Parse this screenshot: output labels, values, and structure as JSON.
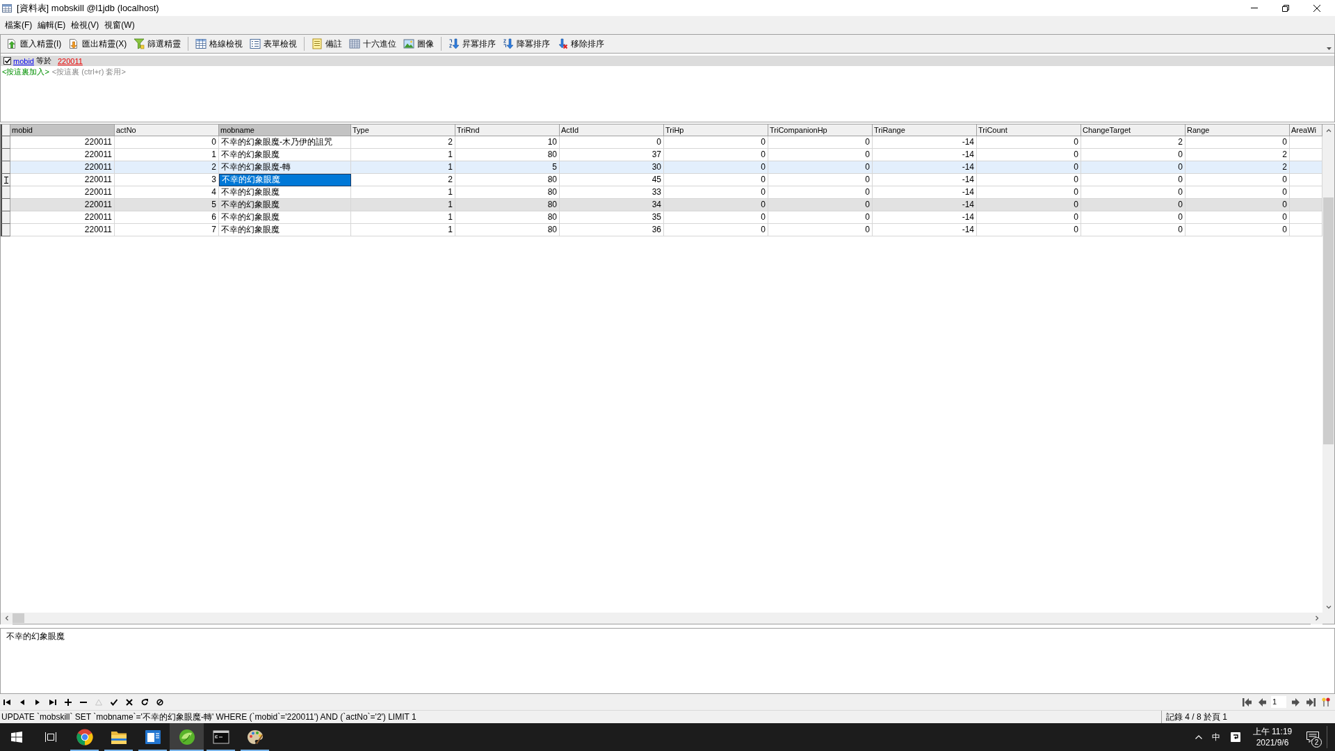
{
  "window": {
    "title": "[資料表] mobskill @l1jdb (localhost)"
  },
  "menu": [
    "檔案(F)",
    "編輯(E)",
    "檢視(V)",
    "視窗(W)"
  ],
  "toolbar": {
    "groups": [
      [
        {
          "kind": "import",
          "label": "匯入精靈(I)"
        },
        {
          "kind": "export",
          "label": "匯出精靈(X)"
        },
        {
          "kind": "filter",
          "label": "篩選精靈"
        }
      ],
      [
        {
          "kind": "grid",
          "label": "格線檢視"
        },
        {
          "kind": "form",
          "label": "表單檢視"
        }
      ],
      [
        {
          "kind": "memo",
          "label": "備註"
        },
        {
          "kind": "hex",
          "label": "十六進位"
        },
        {
          "kind": "image",
          "label": "圖像"
        }
      ],
      [
        {
          "kind": "sort_asc",
          "label": "昇冪排序"
        },
        {
          "kind": "sort_desc",
          "label": "降冪排序"
        },
        {
          "kind": "sort_clear",
          "label": "移除排序"
        }
      ]
    ]
  },
  "filter": {
    "checked": true,
    "field": "mobid",
    "operator": "等於",
    "value": "220011",
    "add_hint": "<按這裏加入>",
    "apply_hint": "<按這裏 (ctrl+r) 套用>"
  },
  "grid": {
    "columns": [
      {
        "label": "mobid",
        "kind": "number",
        "highlighted": true
      },
      {
        "label": "actNo",
        "kind": "number",
        "highlighted": false
      },
      {
        "label": "mobname",
        "kind": "text",
        "highlighted": true
      },
      {
        "label": "Type",
        "kind": "number",
        "highlighted": false
      },
      {
        "label": "TriRnd",
        "kind": "number",
        "highlighted": false
      },
      {
        "label": "ActId",
        "kind": "number",
        "highlighted": false
      },
      {
        "label": "TriHp",
        "kind": "number",
        "highlighted": false
      },
      {
        "label": "TriCompanionHp",
        "kind": "number",
        "highlighted": false
      },
      {
        "label": "TriRange",
        "kind": "number",
        "highlighted": false
      },
      {
        "label": "TriCount",
        "kind": "number",
        "highlighted": false
      },
      {
        "label": "ChangeTarget",
        "kind": "number",
        "highlighted": false
      },
      {
        "label": "Range",
        "kind": "number",
        "highlighted": false
      },
      {
        "label": "AreaWi",
        "kind": "number",
        "highlighted": false
      }
    ],
    "rows": [
      {
        "selected": false,
        "hovered": false,
        "shaded": false,
        "cells": [
          {
            "text": "220011",
            "selected": false
          },
          {
            "text": "0",
            "selected": false
          },
          {
            "text": "不幸的幻象眼魔-木乃伊的詛咒",
            "selected": false
          },
          {
            "text": "2",
            "selected": false
          },
          {
            "text": "10",
            "selected": false
          },
          {
            "text": "0",
            "selected": false
          },
          {
            "text": "0",
            "selected": false
          },
          {
            "text": "0",
            "selected": false
          },
          {
            "text": "-14",
            "selected": false
          },
          {
            "text": "0",
            "selected": false
          },
          {
            "text": "2",
            "selected": false
          },
          {
            "text": "0",
            "selected": false
          }
        ]
      },
      {
        "selected": false,
        "hovered": false,
        "shaded": false,
        "cells": [
          {
            "text": "220011",
            "selected": false
          },
          {
            "text": "1",
            "selected": false
          },
          {
            "text": "不幸的幻象眼魔",
            "selected": false
          },
          {
            "text": "1",
            "selected": false
          },
          {
            "text": "80",
            "selected": false
          },
          {
            "text": "37",
            "selected": false
          },
          {
            "text": "0",
            "selected": false
          },
          {
            "text": "0",
            "selected": false
          },
          {
            "text": "-14",
            "selected": false
          },
          {
            "text": "0",
            "selected": false
          },
          {
            "text": "0",
            "selected": false
          },
          {
            "text": "2",
            "selected": false
          }
        ]
      },
      {
        "selected": false,
        "hovered": true,
        "shaded": false,
        "cells": [
          {
            "text": "220011",
            "selected": false
          },
          {
            "text": "2",
            "selected": false
          },
          {
            "text": "不幸的幻象眼魔-轉",
            "selected": false
          },
          {
            "text": "1",
            "selected": false
          },
          {
            "text": "5",
            "selected": false
          },
          {
            "text": "30",
            "selected": false
          },
          {
            "text": "0",
            "selected": false
          },
          {
            "text": "0",
            "selected": false
          },
          {
            "text": "-14",
            "selected": false
          },
          {
            "text": "0",
            "selected": false
          },
          {
            "text": "0",
            "selected": false
          },
          {
            "text": "2",
            "selected": false
          }
        ]
      },
      {
        "selected": true,
        "hovered": false,
        "shaded": false,
        "cells": [
          {
            "text": "220011",
            "selected": false
          },
          {
            "text": "3",
            "selected": false
          },
          {
            "text": "不幸的幻象眼魔",
            "selected": true
          },
          {
            "text": "2",
            "selected": false
          },
          {
            "text": "80",
            "selected": false
          },
          {
            "text": "45",
            "selected": false
          },
          {
            "text": "0",
            "selected": false
          },
          {
            "text": "0",
            "selected": false
          },
          {
            "text": "-14",
            "selected": false
          },
          {
            "text": "0",
            "selected": false
          },
          {
            "text": "0",
            "selected": false
          },
          {
            "text": "0",
            "selected": false
          }
        ]
      },
      {
        "selected": false,
        "hovered": false,
        "shaded": false,
        "cells": [
          {
            "text": "220011",
            "selected": false
          },
          {
            "text": "4",
            "selected": false
          },
          {
            "text": "不幸的幻象眼魔",
            "selected": false
          },
          {
            "text": "1",
            "selected": false
          },
          {
            "text": "80",
            "selected": false
          },
          {
            "text": "33",
            "selected": false
          },
          {
            "text": "0",
            "selected": false
          },
          {
            "text": "0",
            "selected": false
          },
          {
            "text": "-14",
            "selected": false
          },
          {
            "text": "0",
            "selected": false
          },
          {
            "text": "0",
            "selected": false
          },
          {
            "text": "0",
            "selected": false
          }
        ]
      },
      {
        "selected": false,
        "hovered": false,
        "shaded": true,
        "cells": [
          {
            "text": "220011",
            "selected": false
          },
          {
            "text": "5",
            "selected": false
          },
          {
            "text": "不幸的幻象眼魔",
            "selected": false
          },
          {
            "text": "1",
            "selected": false
          },
          {
            "text": "80",
            "selected": false
          },
          {
            "text": "34",
            "selected": false
          },
          {
            "text": "0",
            "selected": false
          },
          {
            "text": "0",
            "selected": false
          },
          {
            "text": "-14",
            "selected": false
          },
          {
            "text": "0",
            "selected": false
          },
          {
            "text": "0",
            "selected": false
          },
          {
            "text": "0",
            "selected": false
          }
        ]
      },
      {
        "selected": false,
        "hovered": false,
        "shaded": false,
        "cells": [
          {
            "text": "220011",
            "selected": false
          },
          {
            "text": "6",
            "selected": false
          },
          {
            "text": "不幸的幻象眼魔",
            "selected": false
          },
          {
            "text": "1",
            "selected": false
          },
          {
            "text": "80",
            "selected": false
          },
          {
            "text": "35",
            "selected": false
          },
          {
            "text": "0",
            "selected": false
          },
          {
            "text": "0",
            "selected": false
          },
          {
            "text": "-14",
            "selected": false
          },
          {
            "text": "0",
            "selected": false
          },
          {
            "text": "0",
            "selected": false
          },
          {
            "text": "0",
            "selected": false
          }
        ]
      },
      {
        "selected": false,
        "hovered": false,
        "shaded": false,
        "cells": [
          {
            "text": "220011",
            "selected": false
          },
          {
            "text": "7",
            "selected": false
          },
          {
            "text": "不幸的幻象眼魔",
            "selected": false
          },
          {
            "text": "1",
            "selected": false
          },
          {
            "text": "80",
            "selected": false
          },
          {
            "text": "36",
            "selected": false
          },
          {
            "text": "0",
            "selected": false
          },
          {
            "text": "0",
            "selected": false
          },
          {
            "text": "-14",
            "selected": false
          },
          {
            "text": "0",
            "selected": false
          },
          {
            "text": "0",
            "selected": false
          },
          {
            "text": "0",
            "selected": false
          }
        ]
      }
    ]
  },
  "memo": {
    "value": "不幸的幻象眼魔"
  },
  "record_nav": [
    {
      "kind": "first",
      "disabled": false
    },
    {
      "kind": "previous",
      "disabled": false
    },
    {
      "kind": "next",
      "disabled": false
    },
    {
      "kind": "last",
      "disabled": false
    },
    {
      "kind": "add",
      "disabled": false
    },
    {
      "kind": "delete",
      "disabled": false
    },
    {
      "kind": "edit",
      "disabled": true
    },
    {
      "kind": "apply",
      "disabled": false
    },
    {
      "kind": "cancel",
      "disabled": false
    },
    {
      "kind": "refresh",
      "disabled": false
    },
    {
      "kind": "stop",
      "disabled": false
    }
  ],
  "pager": {
    "page": "1"
  },
  "status_bar": {
    "sql": "UPDATE `mobskill` SET `mobname`='不幸的幻象眼魔-轉' WHERE (`mobid`='220011') AND (`actNo`='2') LIMIT 1",
    "record": "記錄 4 / 8 於頁 1"
  },
  "taskbar": {
    "apps": [
      {
        "kind": "browser",
        "running": true,
        "selected": false
      },
      {
        "kind": "folder",
        "running": true,
        "selected": false
      },
      {
        "kind": "window",
        "running": true,
        "selected": false
      },
      {
        "kind": "leaf",
        "running": true,
        "selected": true
      },
      {
        "kind": "terminal",
        "running": true,
        "selected": false
      },
      {
        "kind": "palette",
        "running": true,
        "selected": false
      }
    ],
    "tray": {
      "ime": "中",
      "time": "上午 11:19",
      "date": "2021/9/6",
      "notifications": "2"
    }
  }
}
